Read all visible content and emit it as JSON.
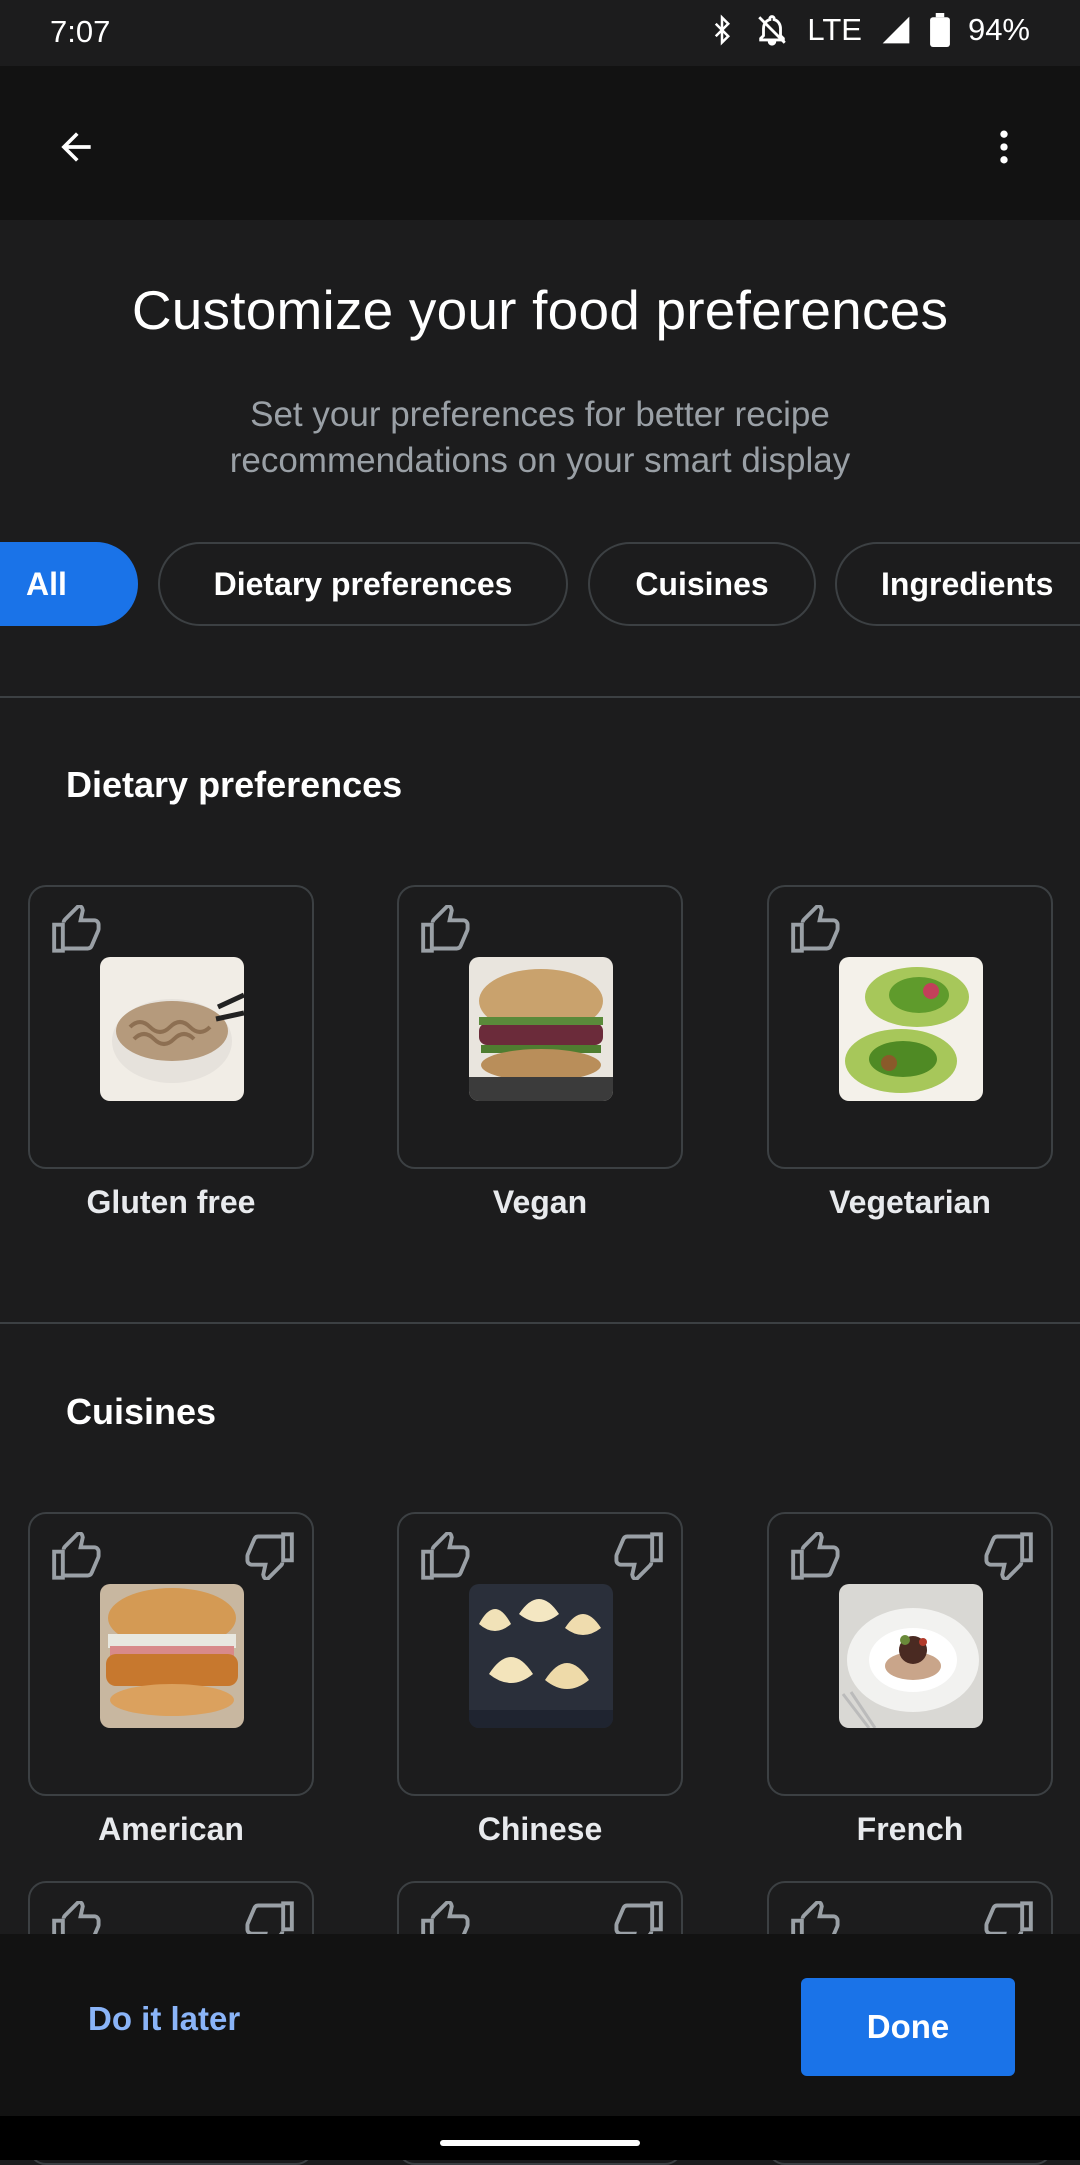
{
  "status": {
    "time": "7:07",
    "network": "LTE",
    "battery": "94%"
  },
  "appbar": {
    "back_icon": "arrow-back-icon",
    "more_icon": "more-vert-icon"
  },
  "header": {
    "title": "Customize your food preferences",
    "subtitle": "Set your preferences for better recipe recommendations on your smart display"
  },
  "chips": [
    {
      "label": "All",
      "selected": true
    },
    {
      "label": "Dietary preferences",
      "selected": false
    },
    {
      "label": "Cuisines",
      "selected": false
    },
    {
      "label": "Ingredients",
      "selected": false
    }
  ],
  "sections": {
    "dietary": {
      "title": "Dietary preferences",
      "items": [
        {
          "label": "Gluten free",
          "image": "gluten-free-noodles"
        },
        {
          "label": "Vegan",
          "image": "vegan-burger"
        },
        {
          "label": "Vegetarian",
          "image": "vegetarian-wrap"
        }
      ]
    },
    "cuisines": {
      "title": "Cuisines",
      "items": [
        {
          "label": "American",
          "image": "american-chicken-burger"
        },
        {
          "label": "Chinese",
          "image": "chinese-dumplings"
        },
        {
          "label": "French",
          "image": "french-plated-dish"
        }
      ]
    }
  },
  "footer": {
    "later_label": "Do it later",
    "done_label": "Done"
  },
  "colors": {
    "accent": "#1a73e8",
    "link": "#8ab4f8",
    "background": "#1c1c1d"
  }
}
